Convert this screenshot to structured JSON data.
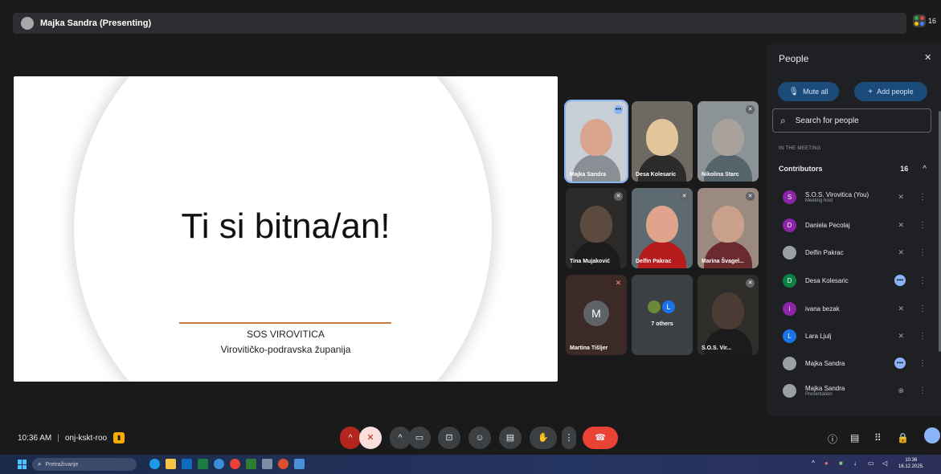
{
  "presenting": {
    "title": "Majka Sandra (Presenting)"
  },
  "top_right": {
    "count": "16"
  },
  "slide": {
    "title": "Ti si bitna/an!",
    "org": "SOS VIROVITICA",
    "region": "Virovitičko-podravska županija"
  },
  "tiles": [
    {
      "name": "Majka Sandra"
    },
    {
      "name": "Desa Kolesaric"
    },
    {
      "name": "Nikolina Starc"
    },
    {
      "name": "Tina Mujaković"
    },
    {
      "name": "Delfin Pakrac"
    },
    {
      "name": "Marina Švagel..."
    },
    {
      "name": "Martina Tišljer",
      "initial": "M"
    },
    {
      "name": "7 others",
      "initial": "L"
    },
    {
      "name": "S.O.S. Vir..."
    }
  ],
  "people": {
    "title": "People",
    "close": "×",
    "mute_all": "Mute all",
    "add_people": "Add people",
    "search_placeholder": "Search for people",
    "section": "IN THE MEETING",
    "contributors_label": "Contributors",
    "contributors_count": "16",
    "rows": [
      {
        "initial": "S",
        "name": "S.O.S. Virovitica (You)",
        "sub": "Meeting host",
        "color": "#8e24aa"
      },
      {
        "initial": "D",
        "name": "Daniela Pecolaj",
        "sub": "",
        "color": "#8e24aa"
      },
      {
        "initial": "",
        "name": "Delfin Pakrac",
        "sub": "",
        "color": "#9aa0a6"
      },
      {
        "initial": "D",
        "name": "Desa Kolesaric",
        "sub": "",
        "color": "#0b8043"
      },
      {
        "initial": "i",
        "name": "ivana bezak",
        "sub": "",
        "color": "#8e24aa"
      },
      {
        "initial": "L",
        "name": "Lara Ljulj",
        "sub": "",
        "color": "#1a73e8"
      },
      {
        "initial": "",
        "name": "Majka Sandra",
        "sub": "",
        "color": "#9aa0a6"
      },
      {
        "initial": "",
        "name": "Majka Sandra",
        "sub": "Presentation",
        "color": "#9aa0a6"
      }
    ]
  },
  "bottom": {
    "time": "10:36 AM",
    "code": "onj-kskt-roo"
  },
  "taskbar": {
    "search": "Pretraživanje",
    "time": "10:36",
    "date": "16.12.2025."
  }
}
